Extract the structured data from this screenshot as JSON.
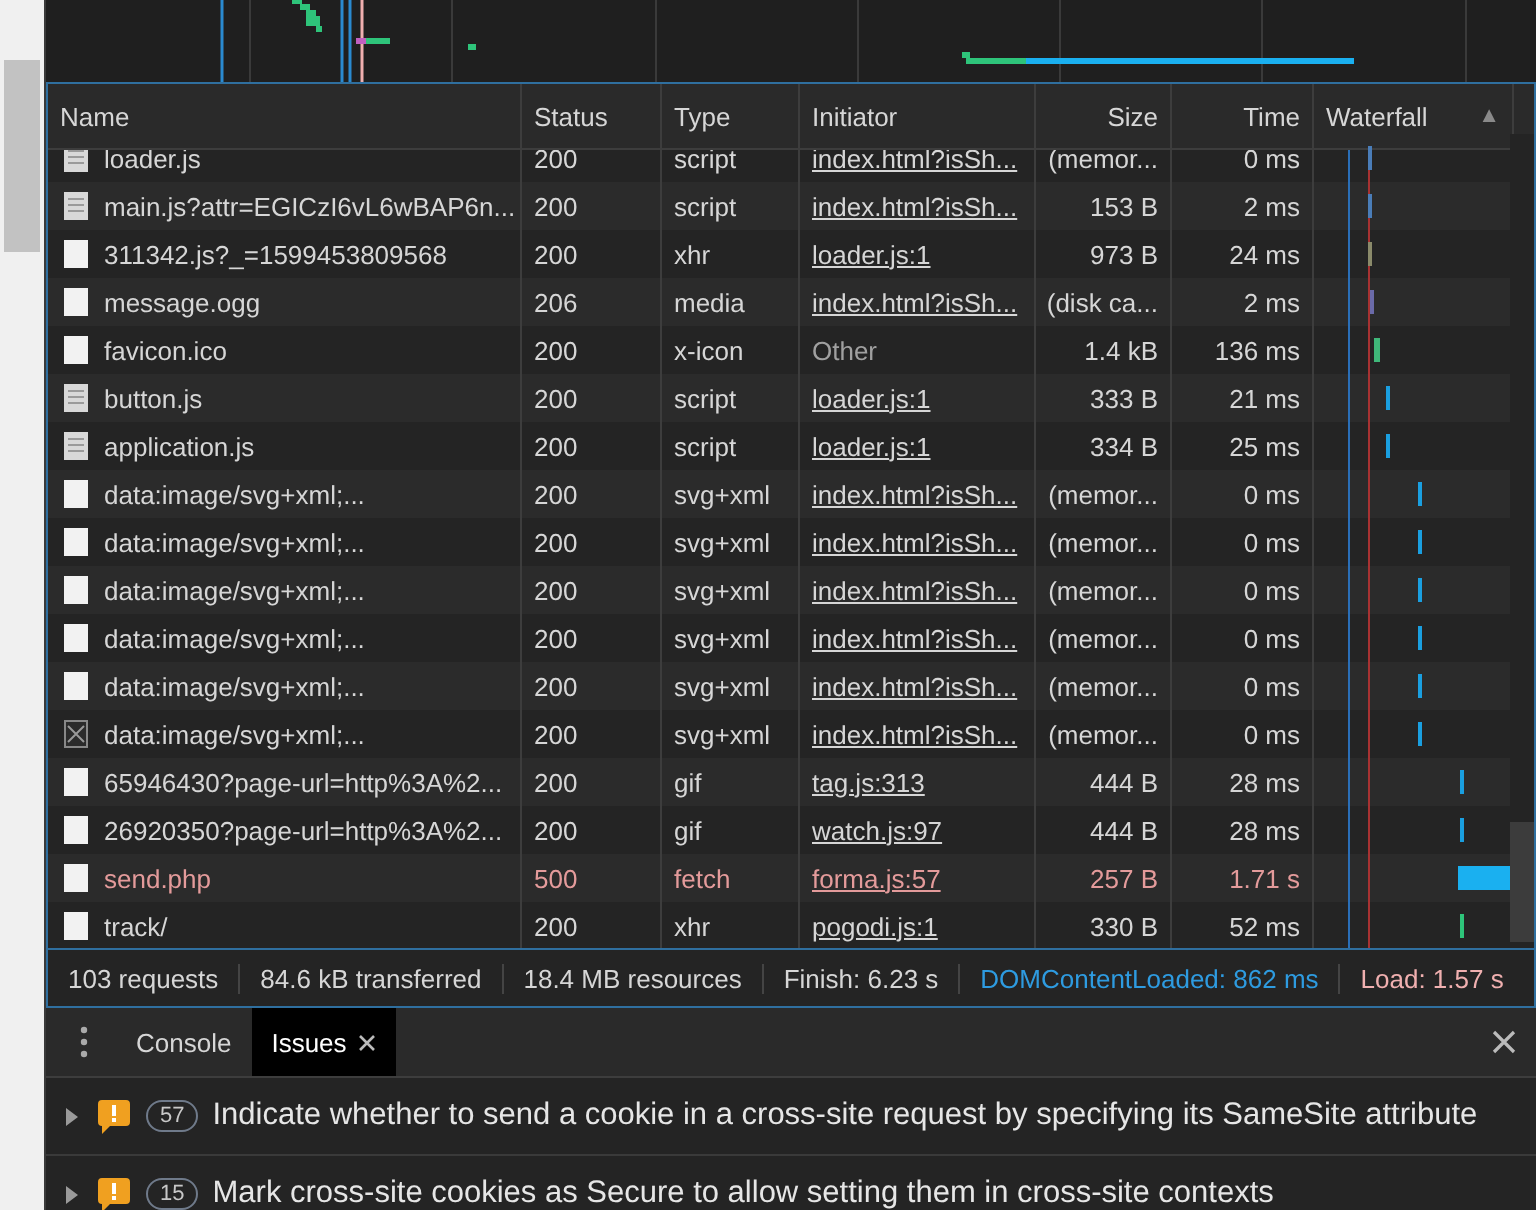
{
  "table": {
    "columns": [
      {
        "label": "Name"
      },
      {
        "label": "Status"
      },
      {
        "label": "Type"
      },
      {
        "label": "Initiator"
      },
      {
        "label": "Size"
      },
      {
        "label": "Time"
      },
      {
        "label": "Waterfall",
        "sort": "▲"
      }
    ],
    "rows": [
      {
        "kind": "script",
        "name": "loader.js",
        "status": "200",
        "type": "script",
        "initiator": "index.html?isSh...",
        "initiator_link": true,
        "size": "(memor...",
        "time": "0 ms",
        "error": false
      },
      {
        "kind": "script",
        "name": "main.js?attr=EGICzI6vL6wBAP6n...",
        "status": "200",
        "type": "script",
        "initiator": "index.html?isSh...",
        "initiator_link": true,
        "size": "153 B",
        "time": "2 ms",
        "error": false
      },
      {
        "kind": "file",
        "name": "311342.js?_=1599453809568",
        "status": "200",
        "type": "xhr",
        "initiator": "loader.js:1",
        "initiator_link": true,
        "size": "973 B",
        "time": "24 ms",
        "error": false
      },
      {
        "kind": "file",
        "name": "message.ogg",
        "status": "206",
        "type": "media",
        "initiator": "index.html?isSh...",
        "initiator_link": true,
        "size": "(disk ca...",
        "time": "2 ms",
        "error": false
      },
      {
        "kind": "file",
        "name": "favicon.ico",
        "status": "200",
        "type": "x-icon",
        "initiator": "Other",
        "initiator_link": false,
        "size": "1.4 kB",
        "time": "136 ms",
        "error": false
      },
      {
        "kind": "script",
        "name": "button.js",
        "status": "200",
        "type": "script",
        "initiator": "loader.js:1",
        "initiator_link": true,
        "size": "333 B",
        "time": "21 ms",
        "error": false
      },
      {
        "kind": "script",
        "name": "application.js",
        "status": "200",
        "type": "script",
        "initiator": "loader.js:1",
        "initiator_link": true,
        "size": "334 B",
        "time": "25 ms",
        "error": false
      },
      {
        "kind": "file",
        "name": "data:image/svg+xml;...",
        "status": "200",
        "type": "svg+xml",
        "initiator": "index.html?isSh...",
        "initiator_link": true,
        "size": "(memor...",
        "time": "0 ms",
        "error": false
      },
      {
        "kind": "file",
        "name": "data:image/svg+xml;...",
        "status": "200",
        "type": "svg+xml",
        "initiator": "index.html?isSh...",
        "initiator_link": true,
        "size": "(memor...",
        "time": "0 ms",
        "error": false
      },
      {
        "kind": "file",
        "name": "data:image/svg+xml;...",
        "status": "200",
        "type": "svg+xml",
        "initiator": "index.html?isSh...",
        "initiator_link": true,
        "size": "(memor...",
        "time": "0 ms",
        "error": false
      },
      {
        "kind": "file",
        "name": "data:image/svg+xml;...",
        "status": "200",
        "type": "svg+xml",
        "initiator": "index.html?isSh...",
        "initiator_link": true,
        "size": "(memor...",
        "time": "0 ms",
        "error": false
      },
      {
        "kind": "file",
        "name": "data:image/svg+xml;...",
        "status": "200",
        "type": "svg+xml",
        "initiator": "index.html?isSh...",
        "initiator_link": true,
        "size": "(memor...",
        "time": "0 ms",
        "error": false
      },
      {
        "kind": "broken",
        "name": "data:image/svg+xml;...",
        "status": "200",
        "type": "svg+xml",
        "initiator": "index.html?isSh...",
        "initiator_link": true,
        "size": "(memor...",
        "time": "0 ms",
        "error": false
      },
      {
        "kind": "file",
        "name": "65946430?page-url=http%3A%2...",
        "status": "200",
        "type": "gif",
        "initiator": "tag.js:313",
        "initiator_link": true,
        "size": "444 B",
        "time": "28 ms",
        "error": false
      },
      {
        "kind": "file",
        "name": "26920350?page-url=http%3A%2...",
        "status": "200",
        "type": "gif",
        "initiator": "watch.js:97",
        "initiator_link": true,
        "size": "444 B",
        "time": "28 ms",
        "error": false
      },
      {
        "kind": "file",
        "name": "send.php",
        "status": "500",
        "type": "fetch",
        "initiator": "forma.js:57",
        "initiator_link": true,
        "size": "257 B",
        "time": "1.71 s",
        "error": true
      },
      {
        "kind": "file",
        "name": "track/",
        "status": "200",
        "type": "xhr",
        "initiator": "pogodi.js:1",
        "initiator_link": true,
        "size": "330 B",
        "time": "52 ms",
        "error": false
      }
    ]
  },
  "status_bar": [
    {
      "text": "103 requests",
      "kind": "plain"
    },
    {
      "text": "84.6 kB transferred",
      "kind": "plain"
    },
    {
      "text": "18.4 MB resources",
      "kind": "plain"
    },
    {
      "text": "Finish: 6.23 s",
      "kind": "plain"
    },
    {
      "text": "DOMContentLoaded: 862 ms",
      "kind": "dom"
    },
    {
      "text": "Load: 1.57 s",
      "kind": "load"
    }
  ],
  "drawer": {
    "tabs": [
      {
        "label": "Console",
        "selected": false,
        "closable": false
      },
      {
        "label": "Issues",
        "selected": true,
        "closable": true
      }
    ],
    "issues": [
      {
        "count": "57",
        "text": "Indicate whether to send a cookie in a cross-site request by specifying its SameSite attribute"
      },
      {
        "count": "15",
        "text": "Mark cross-site cookies as Secure to allow setting them in cross-site contexts"
      }
    ]
  }
}
